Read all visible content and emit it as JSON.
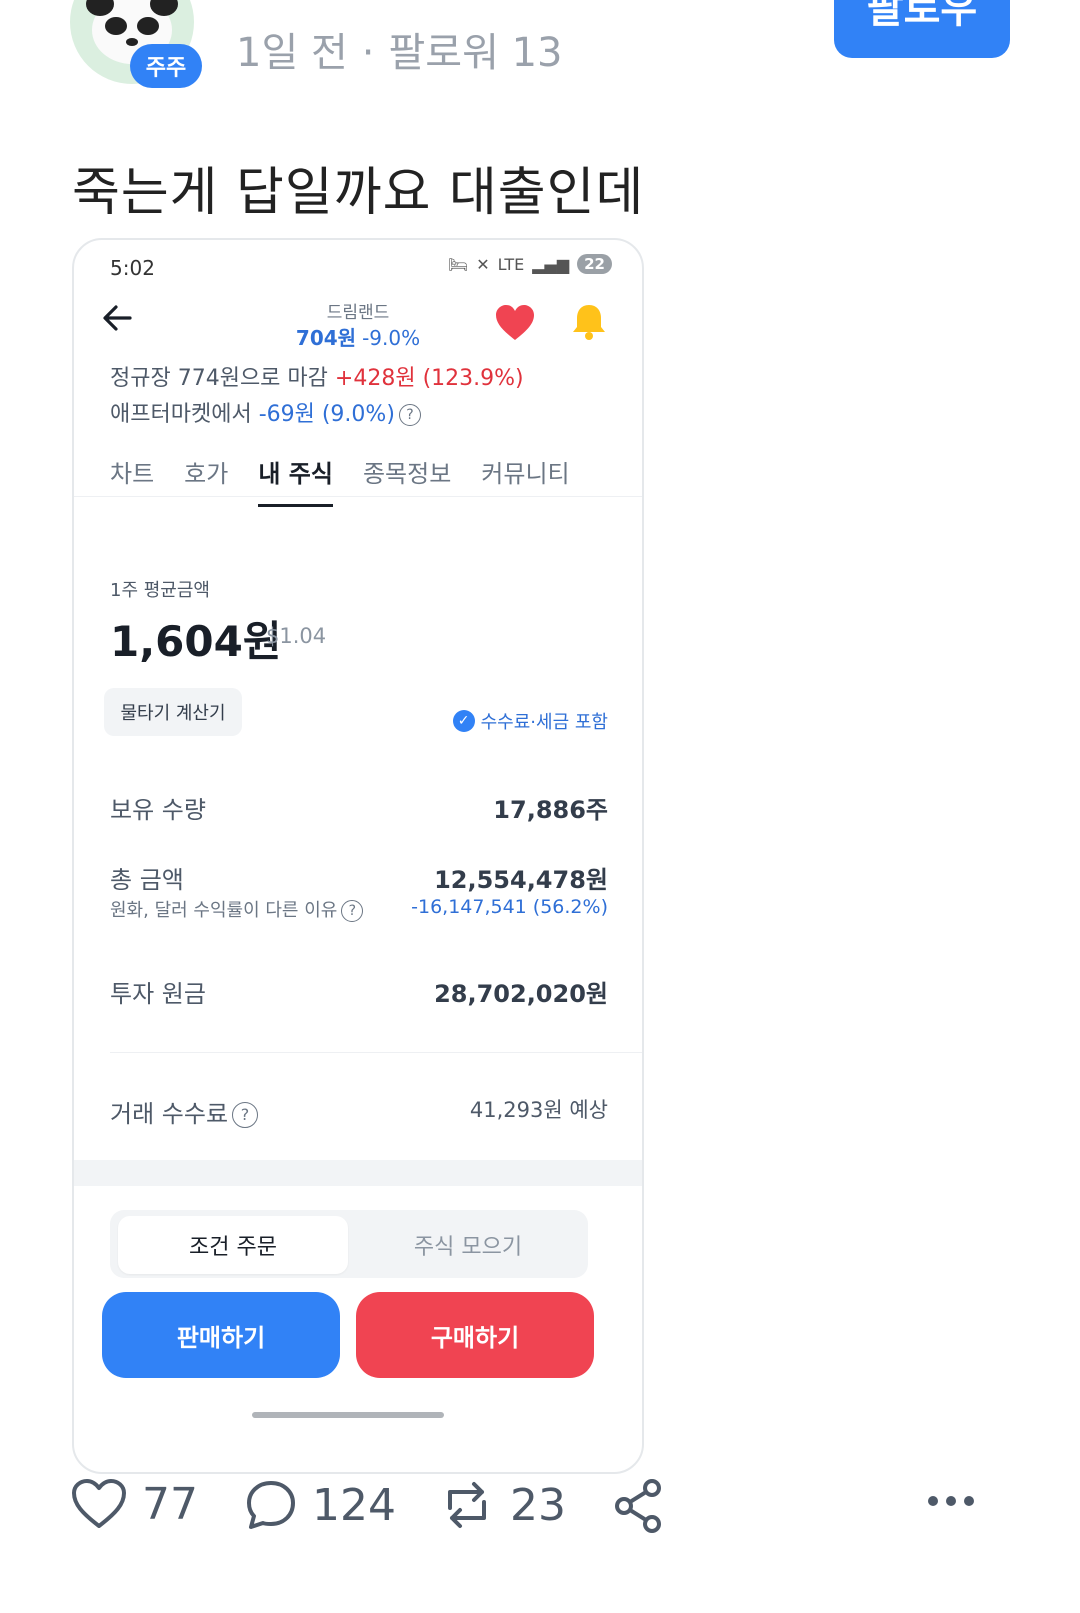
{
  "post": {
    "author_badge": "주주",
    "meta_time": "1일 전",
    "meta_sep": "·",
    "meta_followers": "팔로워 13",
    "follow_label": "팔로우",
    "text": "죽는게 답일까요 대출인데"
  },
  "screenshot": {
    "status_time": "5:02",
    "status_network": "LTE",
    "battery": "22",
    "stock_name": "드림랜드",
    "price": "704원",
    "change": "-9.0%",
    "close_prefix": "정규장 774원으로 마감",
    "close_change": "+428원 (123.9%)",
    "after_prefix": "애프터마켓에서",
    "after_change": "-69원 (9.0%)",
    "help_glyph": "?",
    "tabs": [
      {
        "label": "차트",
        "active": false
      },
      {
        "label": "호가",
        "active": false
      },
      {
        "label": "내 주식",
        "active": true
      },
      {
        "label": "종목정보",
        "active": false
      },
      {
        "label": "커뮤니티",
        "active": false
      }
    ],
    "avg_label": "1주 평균금액",
    "avg_value": "1,604원",
    "avg_usd": "$1.04",
    "calc_button": "물타기 계산기",
    "fee_note": "수수료·세금 포함",
    "holdings_label": "보유 수량",
    "holdings_value": "17,886주",
    "total_label": "총 금액",
    "total_value": "12,554,478원",
    "total_sub_label": "원화, 달러 수익률이 다른 이유",
    "total_sub_value": "-16,147,541 (56.2%)",
    "principal_label": "투자 원금",
    "principal_value": "28,702,020원",
    "fee_label": "거래 수수료",
    "fee_value": "41,293원 예상",
    "seg_on": "조건 주문",
    "seg_off": "주식 모으기",
    "sell_button": "판매하기",
    "buy_button": "구매하기"
  },
  "actions": {
    "likes": "77",
    "comments": "124",
    "reposts": "23"
  },
  "colors": {
    "accent_blue": "#3182f6",
    "buy_red": "#f04452",
    "up_red": "#e0323c",
    "down_blue": "#2f6fd6"
  }
}
